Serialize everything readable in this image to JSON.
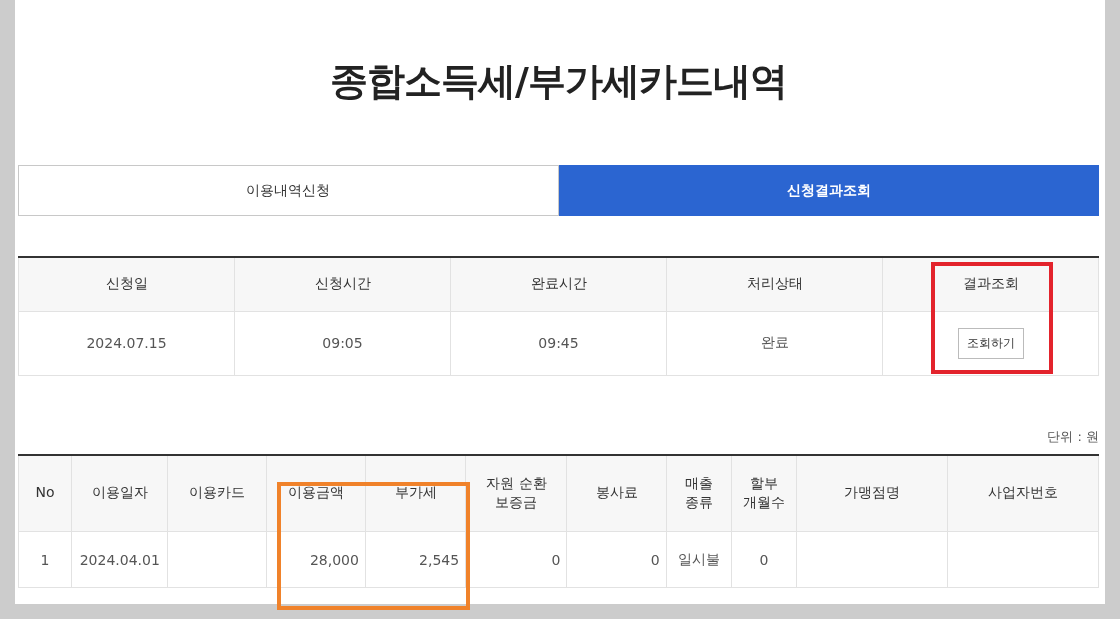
{
  "title": "종합소득세/부가세카드내역",
  "tabs": [
    {
      "label": "이용내역신청",
      "selected": false
    },
    {
      "label": "신청결과조회",
      "selected": true
    }
  ],
  "request_table": {
    "columns": [
      "신청일",
      "신청시간",
      "완료시간",
      "처리상태",
      "결과조회"
    ],
    "rows": [
      {
        "cells": [
          "2024.07.15",
          "09:05",
          "09:45",
          "완료"
        ],
        "button": "조회하기"
      }
    ]
  },
  "unit_label": "단위 : 원",
  "usage_table": {
    "columns": [
      "No",
      "이용일자",
      "이용카드",
      "이용금액",
      "부가세",
      "자원 순환 보증금",
      "봉사료",
      "매출 종류",
      "할부 개월수",
      "가맹점명",
      "사업자번호"
    ],
    "rows": [
      {
        "cells": [
          "1",
          "2024.04.01",
          null,
          "28,000",
          "2,545",
          "0",
          "0",
          "일시불",
          "0",
          null,
          null
        ]
      }
    ]
  },
  "highlights": [
    {
      "color": "#e3232c"
    },
    {
      "color": "#f0822a"
    }
  ]
}
